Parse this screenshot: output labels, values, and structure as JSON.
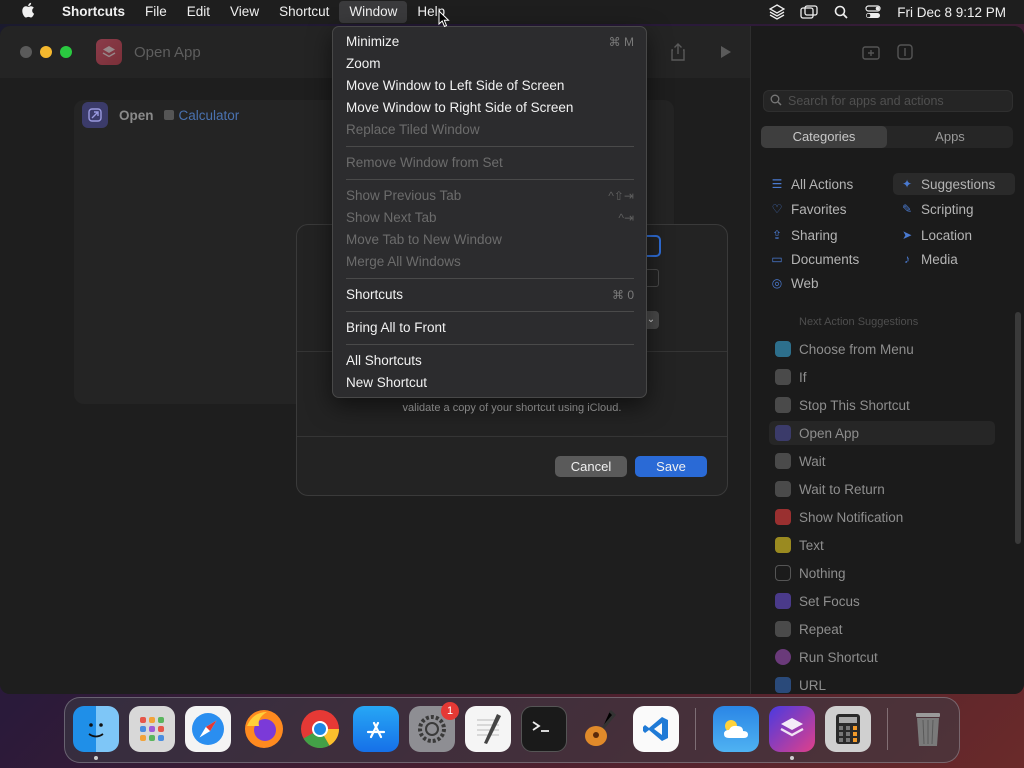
{
  "menubar": {
    "app_name": "Shortcuts",
    "items": [
      "File",
      "Edit",
      "View",
      "Shortcut",
      "Window",
      "Help"
    ],
    "clock": "Fri Dec 8  9:12 PM",
    "icons": [
      "layers-icon",
      "window-icon",
      "search-icon",
      "control-center-icon"
    ]
  },
  "window": {
    "title": "Open App",
    "action": {
      "verb": "Open",
      "target": "Calculator"
    }
  },
  "sidebar": {
    "search_placeholder": "Search for apps and actions",
    "tabs": [
      "Categories",
      "Apps"
    ],
    "categories_left": [
      "All Actions",
      "Favorites",
      "Sharing",
      "Documents",
      "Web"
    ],
    "categories_right": [
      "Suggestions",
      "Scripting",
      "Location",
      "Media"
    ],
    "next_action_header": "Next Action Suggestions",
    "suggestions": [
      "Choose from Menu",
      "If",
      "Stop This Shortcut",
      "Open App",
      "Wait",
      "Wait to Return",
      "Show Notification",
      "Text",
      "Nothing",
      "Set Focus",
      "Repeat",
      "Run Shortcut",
      "URL"
    ]
  },
  "dialog": {
    "text": "validate a copy of your shortcut using iCloud.",
    "cancel": "Cancel",
    "save": "Save"
  },
  "window_menu": {
    "items": [
      {
        "label": "Minimize",
        "shortcut": "⌘ M",
        "disabled": false
      },
      {
        "label": "Zoom",
        "shortcut": "",
        "disabled": false
      },
      {
        "label": "Move Window to Left Side of Screen",
        "shortcut": "",
        "disabled": false
      },
      {
        "label": "Move Window to Right Side of Screen",
        "shortcut": "",
        "disabled": false
      },
      {
        "label": "Replace Tiled Window",
        "shortcut": "",
        "disabled": true
      },
      {
        "label": "Remove Window from Set",
        "shortcut": "",
        "disabled": true
      },
      {
        "label": "Show Previous Tab",
        "shortcut": "^⇧⇥",
        "disabled": true
      },
      {
        "label": "Show Next Tab",
        "shortcut": "^⇥",
        "disabled": true
      },
      {
        "label": "Move Tab to New Window",
        "shortcut": "",
        "disabled": true
      },
      {
        "label": "Merge All Windows",
        "shortcut": "",
        "disabled": true
      },
      {
        "label": "Shortcuts",
        "shortcut": "⌘ 0",
        "disabled": false
      },
      {
        "label": "Bring All to Front",
        "shortcut": "",
        "disabled": false
      },
      {
        "label": "All Shortcuts",
        "shortcut": "",
        "disabled": false
      },
      {
        "label": "New Shortcut",
        "shortcut": "",
        "disabled": false
      }
    ]
  },
  "dock": {
    "apps": [
      "finder-icon",
      "launchpad-icon",
      "safari-icon",
      "firefox-icon",
      "chrome-icon",
      "app-store-icon",
      "system-settings-icon",
      "textedit-icon",
      "terminal-icon",
      "garageband-icon",
      "vscode-icon",
      "weather-icon",
      "shortcuts-icon",
      "calculator-icon",
      "trash-icon"
    ],
    "settings_badge": "1"
  }
}
